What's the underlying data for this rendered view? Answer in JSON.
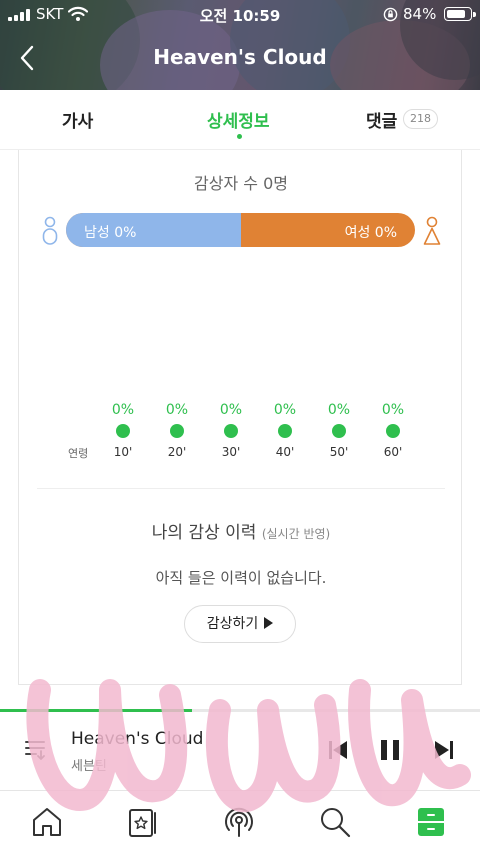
{
  "status_bar": {
    "carrier": "SKT",
    "time": "오전 10:59",
    "battery": "84%",
    "battery_level": 0.84
  },
  "nav": {
    "title": "Heaven's Cloud"
  },
  "tabs": [
    {
      "label": "가사",
      "active": false
    },
    {
      "label": "상세정보",
      "active": true
    },
    {
      "label": "댓글",
      "active": false,
      "count": "218"
    }
  ],
  "listeners": {
    "title": "감상자 수 0명",
    "male_label": "남성 0%",
    "female_label": "여성 0%",
    "male_ratio": 0.5,
    "male_color": "#8fb6ea",
    "female_color": "#e08234"
  },
  "age": {
    "label": "연령",
    "groups": [
      {
        "pct": "0%",
        "label": "10'"
      },
      {
        "pct": "0%",
        "label": "20'"
      },
      {
        "pct": "0%",
        "label": "30'"
      },
      {
        "pct": "0%",
        "label": "40'"
      },
      {
        "pct": "0%",
        "label": "50'"
      },
      {
        "pct": "0%",
        "label": "60'"
      }
    ]
  },
  "history": {
    "title": "나의 감상 이력",
    "subtitle": "(실시간 반영)",
    "empty_message": "아직 들은 이력이 없습니다.",
    "button_label": "감상하기"
  },
  "player": {
    "title": "Heaven's Cloud",
    "artist": "세븐틴",
    "progress": 0.4
  },
  "accent_color": "#2fbf4e",
  "icons": [
    "back-icon",
    "male-icon",
    "female-icon",
    "queue-icon",
    "previous-icon",
    "pause-icon",
    "next-icon",
    "home-icon",
    "my-music-icon",
    "podcast-icon",
    "search-icon",
    "drawer-icon"
  ]
}
